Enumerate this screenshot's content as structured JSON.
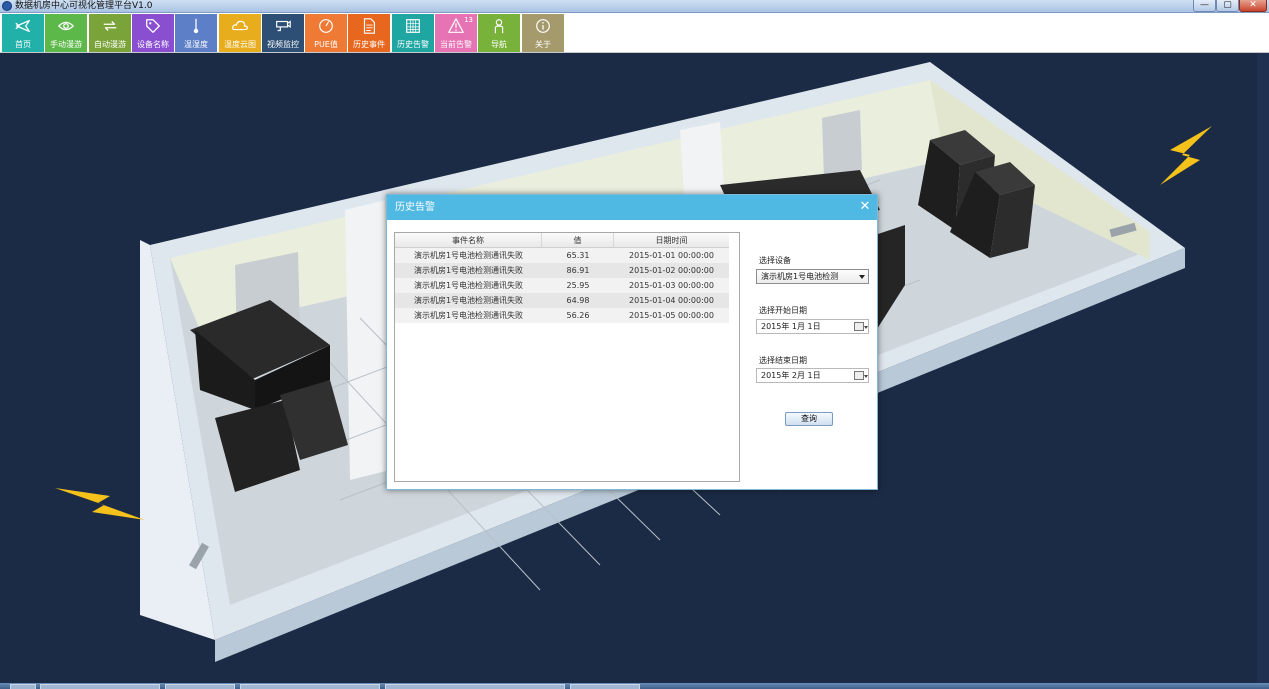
{
  "window": {
    "title": "数据机房中心可视化管理平台V1.0",
    "min": "—",
    "max": "▢",
    "close": "✕"
  },
  "toolbar": {
    "tools": [
      {
        "label": "首页",
        "icon": "airplane-icon",
        "color": "#22b1a8"
      },
      {
        "label": "手动漫游",
        "icon": "eye-icon",
        "color": "#5db84a"
      },
      {
        "label": "自动漫游",
        "icon": "loop-arrows-icon",
        "color": "#7aa33a"
      },
      {
        "label": "设备名称",
        "icon": "tag-icon",
        "color": "#8a4fd0"
      },
      {
        "label": "温湿度",
        "icon": "thermometer-icon",
        "color": "#5c7fc7"
      },
      {
        "label": "温度云图",
        "icon": "cloud-icon",
        "color": "#e8ad1d"
      },
      {
        "label": "视频监控",
        "icon": "camera-icon",
        "color": "#2d4f75"
      },
      {
        "label": "PUE值",
        "icon": "gauge-icon",
        "color": "#ef7a36"
      },
      {
        "label": "历史事件",
        "icon": "document-icon",
        "color": "#e8671f"
      },
      {
        "label": "历史告警",
        "icon": "calendar-grid-icon",
        "color": "#1fa6a2"
      },
      {
        "label": "当前告警",
        "icon": "warning-icon",
        "color": "#e673b3",
        "count": "13"
      },
      {
        "label": "导航",
        "icon": "person-icon",
        "color": "#79b23a"
      },
      {
        "label": "关于",
        "icon": "info-icon",
        "color": "#a59a6b"
      }
    ]
  },
  "dialog": {
    "title": "历史告警",
    "close": "✕",
    "columns": [
      "事件名称",
      "值",
      "日期时间"
    ],
    "rows": [
      {
        "name": "演示机房1号电池检测通讯失败",
        "value": "65.31",
        "datetime": "2015-01-01 00:00:00"
      },
      {
        "name": "演示机房1号电池检测通讯失败",
        "value": "86.91",
        "datetime": "2015-01-02 00:00:00"
      },
      {
        "name": "演示机房1号电池检测通讯失败",
        "value": "25.95",
        "datetime": "2015-01-03 00:00:00"
      },
      {
        "name": "演示机房1号电池检测通讯失败",
        "value": "64.98",
        "datetime": "2015-01-04 00:00:00"
      },
      {
        "name": "演示机房1号电池检测通讯失败",
        "value": "56.26",
        "datetime": "2015-01-05 00:00:00"
      }
    ],
    "device_label": "选择设备",
    "device_value": "演示机房1号电池检测",
    "start_label": "选择开始日期",
    "start_value": "2015年  1月  1日",
    "end_label": "选择结束日期",
    "end_value": "2015年  2月  1日",
    "query_label": "查询"
  },
  "colors": {
    "background": "#1c2b45",
    "dialog_header": "#4fb8e3",
    "lightning": "#f5c21b"
  }
}
